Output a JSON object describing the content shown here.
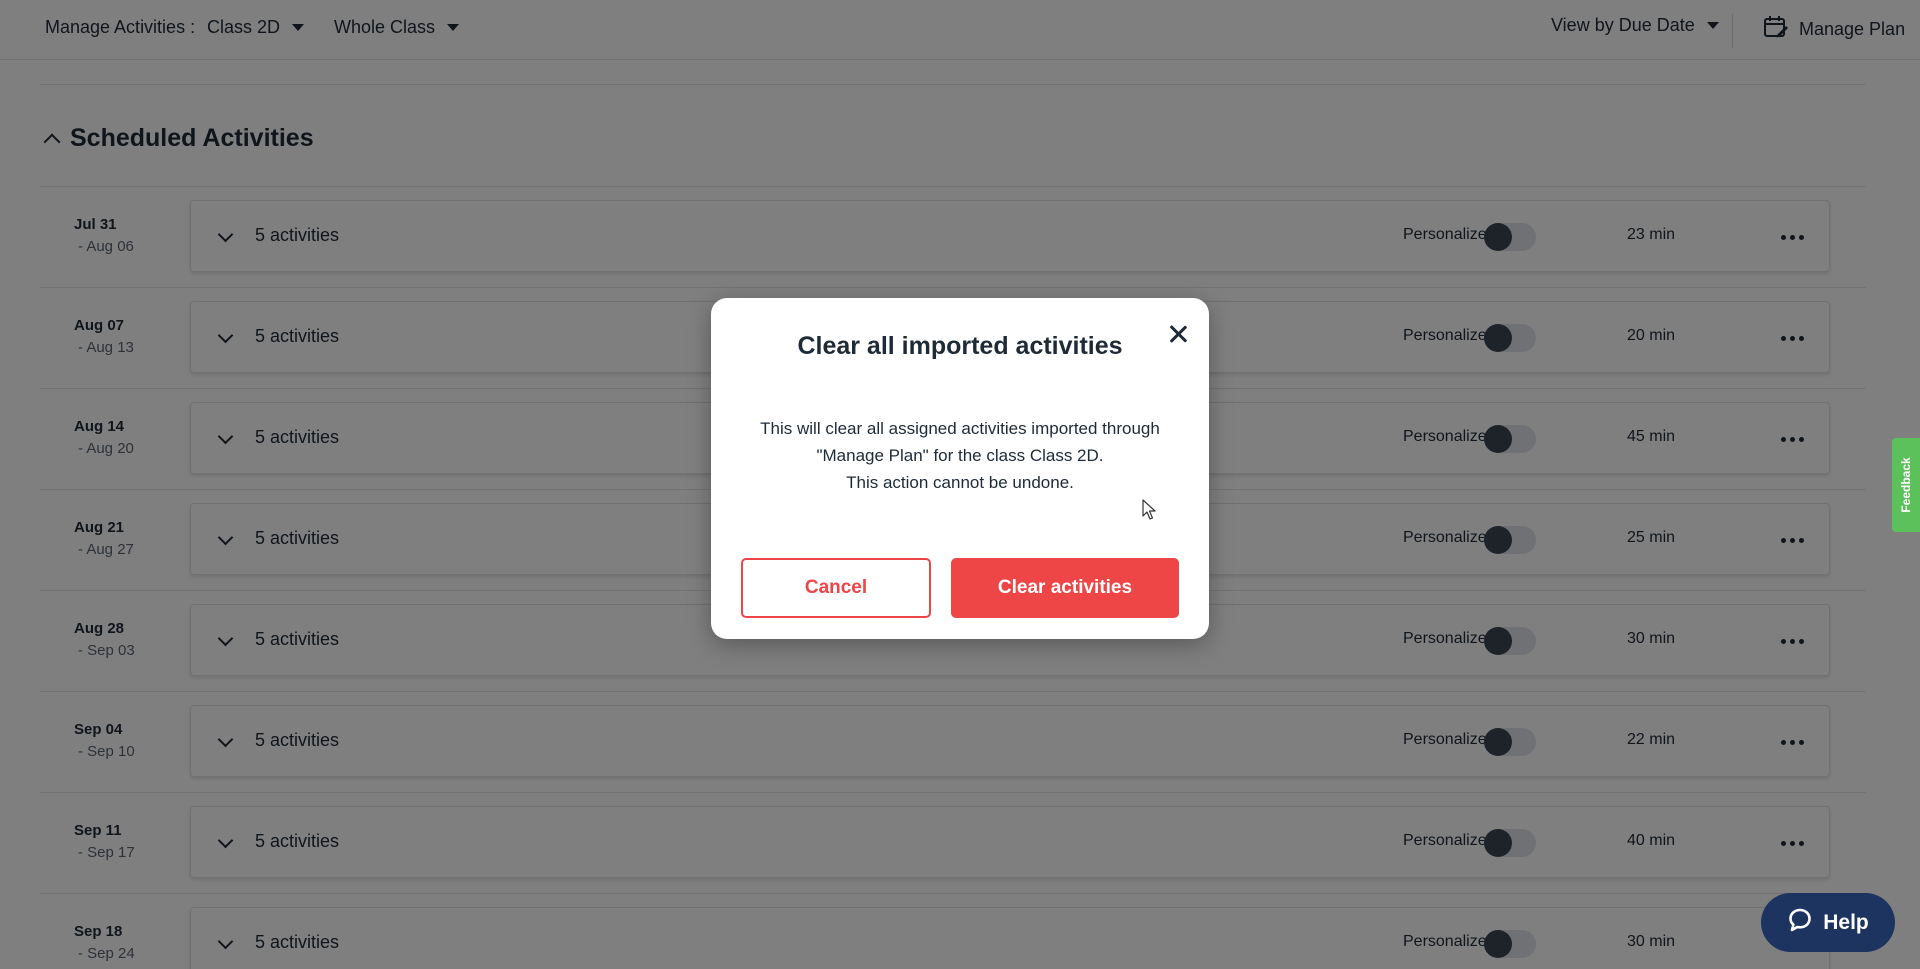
{
  "header": {
    "label": "Manage Activities :",
    "class_select": "Class 2D",
    "group_select": "Whole Class",
    "view_select": "View by Due Date",
    "manage_plan": "Manage Plan"
  },
  "section": {
    "title": "Scheduled Activities"
  },
  "rows": [
    {
      "start": "Jul 31",
      "end": "- Aug 06",
      "count": "5 activities",
      "personalize": "Personalize",
      "duration": "23 min"
    },
    {
      "start": "Aug 07",
      "end": "- Aug 13",
      "count": "5 activities",
      "personalize": "Personalize",
      "duration": "20 min"
    },
    {
      "start": "Aug 14",
      "end": "- Aug 20",
      "count": "5 activities",
      "personalize": "Personalize",
      "duration": "45 min"
    },
    {
      "start": "Aug 21",
      "end": "- Aug 27",
      "count": "5 activities",
      "personalize": "Personalize",
      "duration": "25 min"
    },
    {
      "start": "Aug 28",
      "end": "- Sep 03",
      "count": "5 activities",
      "personalize": "Personalize",
      "duration": "30 min"
    },
    {
      "start": "Sep 04",
      "end": "- Sep 10",
      "count": "5 activities",
      "personalize": "Personalize",
      "duration": "22 min"
    },
    {
      "start": "Sep 11",
      "end": "- Sep 17",
      "count": "5 activities",
      "personalize": "Personalize",
      "duration": "40 min"
    },
    {
      "start": "Sep 18",
      "end": "- Sep 24",
      "count": "5 activities",
      "personalize": "Personalize",
      "duration": "30 min"
    }
  ],
  "modal": {
    "title": "Clear all imported activities",
    "body_line1": "This will clear all assigned activities imported through",
    "body_line2": "\"Manage Plan\" for the class Class 2D.",
    "body_line3": "This action cannot be undone.",
    "cancel_label": "Cancel",
    "confirm_label": "Clear activities"
  },
  "feedback_label": "Feedback",
  "help_label": "Help",
  "colors": {
    "primary_red": "#ee4547",
    "navy": "#1d3461",
    "feedback_green": "#5cc15a",
    "text": "#1f2a37"
  },
  "icons": {
    "manage_plan": "calendar-edit-icon",
    "close": "close-icon",
    "help": "chat-bubble-icon",
    "more": "more-horizontal-icon",
    "expand": "chevron-down-icon",
    "collapse": "chevron-up-icon"
  }
}
